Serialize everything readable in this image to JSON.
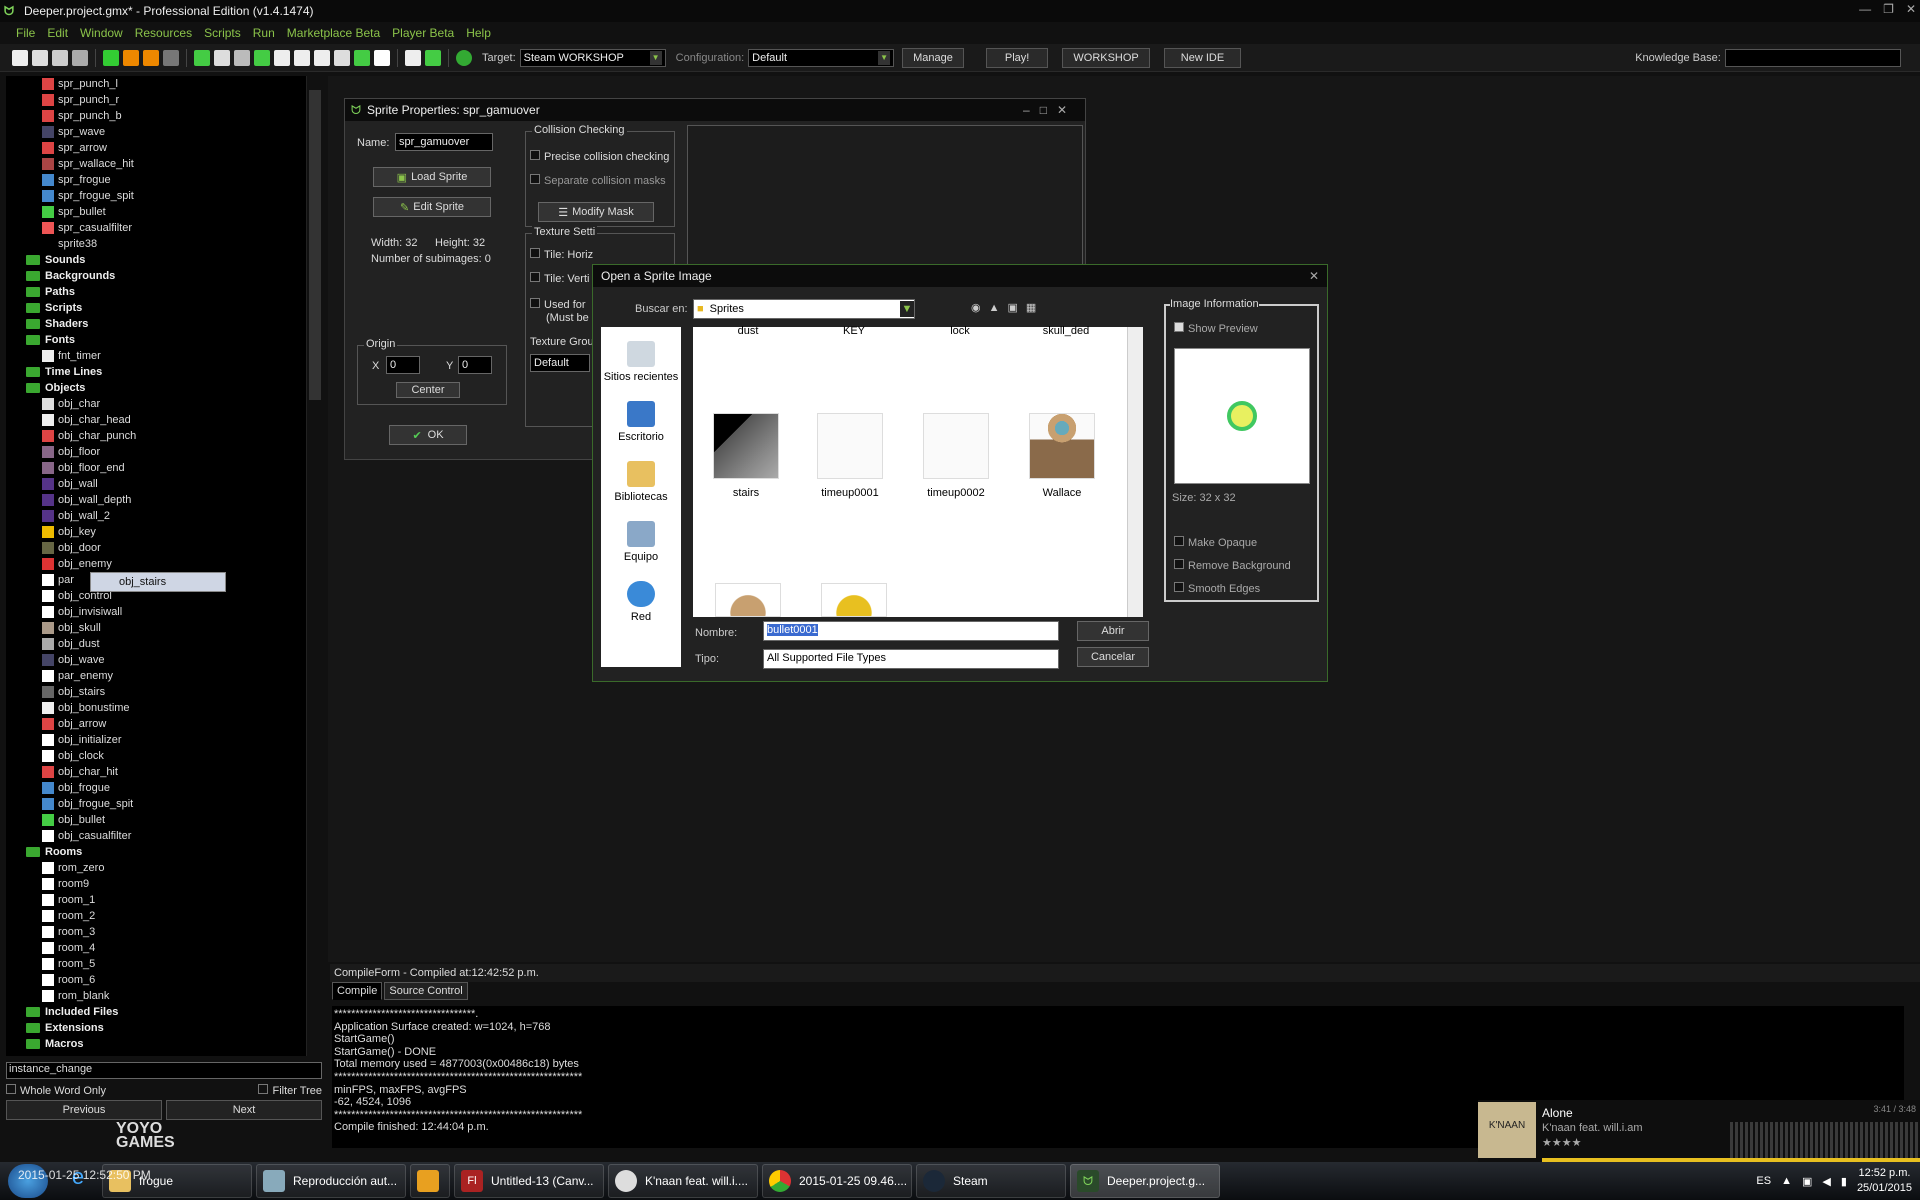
{
  "window": {
    "title": "Deeper.project.gmx*  -  Professional Edition (v1.4.1474)"
  },
  "menu": [
    "File",
    "Edit",
    "Window",
    "Resources",
    "Scripts",
    "Run",
    "Marketplace Beta",
    "Player Beta",
    "Help"
  ],
  "toolbar": {
    "target_label": "Target:",
    "target_value": "Steam WORKSHOP",
    "config_label": "Configuration:",
    "config_value": "Default",
    "manage": "Manage",
    "play": "Play!",
    "workshop": "WORKSHOP",
    "new_ide": "New IDE",
    "kb_label": "Knowledge Base:"
  },
  "tree": {
    "sprites": [
      "spr_punch_l",
      "spr_punch_r",
      "spr_punch_b",
      "spr_wave",
      "spr_arrow",
      "spr_wallace_hit",
      "spr_frogue",
      "spr_frogue_spit",
      "spr_bullet",
      "spr_casualfilter",
      "sprite38"
    ],
    "folders_mid": [
      "Sounds",
      "Backgrounds",
      "Paths",
      "Scripts",
      "Shaders"
    ],
    "fonts_label": "Fonts",
    "fonts": [
      "fnt_timer"
    ],
    "timelines": "Time Lines",
    "objects_label": "Objects",
    "objects": [
      "obj_char",
      "obj_char_head",
      "obj_char_punch",
      "obj_floor",
      "obj_floor_end",
      "obj_wall",
      "obj_wall_depth",
      "obj_wall_2",
      "obj_key",
      "obj_door",
      "obj_enemy",
      "par",
      "obj_control",
      "obj_invisiwall",
      "obj_skull",
      "obj_dust",
      "obj_wave",
      "par_enemy",
      "obj_stairs",
      "obj_bonustime",
      "obj_arrow",
      "obj_initializer",
      "obj_clock",
      "obj_char_hit",
      "obj_frogue",
      "obj_frogue_spit",
      "obj_bullet",
      "obj_casualfilter"
    ],
    "rooms_label": "Rooms",
    "rooms": [
      "rom_zero",
      "room9",
      "room_1",
      "room_2",
      "room_3",
      "room_4",
      "room_5",
      "room_6",
      "rom_blank"
    ],
    "bottom_folders": [
      "Included Files",
      "Extensions",
      "Macros"
    ],
    "drag_ghost": "obj_stairs"
  },
  "search": {
    "value": "instance_change",
    "whole_word": "Whole Word Only",
    "filter_tree": "Filter Tree",
    "previous": "Previous",
    "next": "Next"
  },
  "logo": {
    "line1": "YOYO",
    "line2": "GAMES"
  },
  "sprite_props": {
    "title": "Sprite Properties: spr_gamuover",
    "name_label": "Name:",
    "name_value": "spr_gamuover",
    "load_sprite": "Load Sprite",
    "edit_sprite": "Edit Sprite",
    "width": "Width: 32",
    "height": "Height: 32",
    "subimages": "Number of subimages: 0",
    "collision_title": "Collision Checking",
    "precise": "Precise collision checking",
    "separate": "Separate collision masks",
    "modify_mask": "Modify Mask",
    "texture_title": "Texture Setti",
    "tile_h": "Tile: Horiz",
    "tile_v": "Tile: Verti",
    "used_for": "Used for",
    "must_be": "(Must be",
    "texture_group": "Texture Grou",
    "texture_group_value": "Default",
    "origin_title": "Origin",
    "x_label": "X",
    "x_value": "0",
    "y_label": "Y",
    "y_value": "0",
    "center": "Center",
    "ok": "OK"
  },
  "open_dialog": {
    "title": "Open a Sprite Image",
    "look_in_label": "Buscar en:",
    "look_in_value": "Sprites",
    "places": [
      "Sitios recientes",
      "Escritorio",
      "Bibliotecas",
      "Equipo",
      "Red"
    ],
    "top_labels": [
      "dust",
      "KEY",
      "lock",
      "skull_ded"
    ],
    "files": [
      "stairs",
      "timeup0001",
      "timeup0002",
      "Wallace"
    ],
    "name_label": "Nombre:",
    "name_value": "bullet0001",
    "type_label": "Tipo:",
    "type_value": "All Supported File Types",
    "open": "Abrir",
    "cancel": "Cancelar",
    "info_title": "Image Information",
    "show_preview": "Show Preview",
    "size": "Size: 32 x 32",
    "make_opaque": "Make Opaque",
    "remove_bg": "Remove Background",
    "smooth": "Smooth Edges"
  },
  "compile": {
    "header": "CompileForm - Compiled at:12:42:52 p.m.",
    "tabs": [
      "Compile",
      "Source Control"
    ],
    "output": "*********************************.\nApplication Surface created: w=1024, h=768\nStartGame()\nStartGame() - DONE\nTotal memory used = 4877003(0x00486c18) bytes\n**********************************************************\nminFPS, maxFPS, avgFPS\n-62, 4524, 1096\n**********************************************************\nCompile finished: 12:44:04 p.m."
  },
  "music": {
    "title": "Alone",
    "artist": "K'naan feat. will.i.am",
    "time": "3:41 / 3:48",
    "album": "K'NAAN"
  },
  "taskbar": {
    "tasks": [
      "frogue",
      "Reproducción aut...",
      "",
      "Untitled-13 (Canv...",
      "K'naan feat. will.i....",
      "2015-01-25 09.46....",
      "Steam",
      "Deeper.project.g..."
    ],
    "lang": "ES",
    "time": "12:52 p.m.",
    "date": "25/01/2015",
    "overlay": "2015-01-25 12:52:50 PM"
  },
  "colors": {
    "accent": "#8bc34a",
    "folder": "#3aa830",
    "bg": "#111111"
  }
}
